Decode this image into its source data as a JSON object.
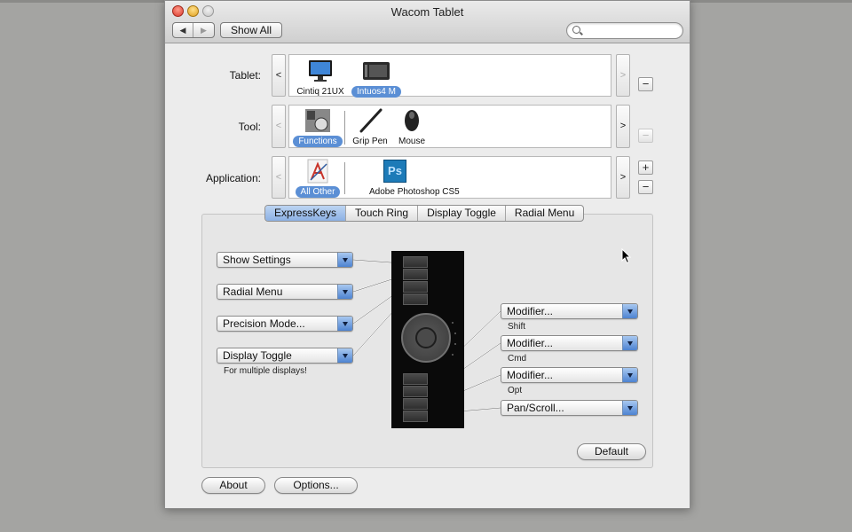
{
  "window": {
    "title": "Wacom Tablet"
  },
  "toolbar": {
    "back_glyph": "◀",
    "forward_glyph": "▶",
    "show_all": "Show All",
    "search_placeholder": ""
  },
  "rows": {
    "tablet": {
      "label": "Tablet:",
      "items": [
        {
          "name": "Cintiq 21UX",
          "icon": "monitor-icon"
        },
        {
          "name": "Intuos4 M",
          "icon": "tablet-icon",
          "selected": true
        }
      ],
      "side_buttons": [
        "−"
      ]
    },
    "tool": {
      "label": "Tool:",
      "items": [
        {
          "name": "Functions",
          "icon": "functions-icon",
          "selected": true
        },
        {
          "name": "Grip Pen",
          "icon": "pen-icon"
        },
        {
          "name": "Mouse",
          "icon": "mouse-icon"
        }
      ],
      "side_buttons": [
        "−"
      ]
    },
    "application": {
      "label": "Application:",
      "items": [
        {
          "name": "All Other",
          "icon": "all-other-apps-icon",
          "selected": true
        },
        {
          "name": "Adobe Photoshop CS5",
          "icon": "photoshop-icon",
          "badge": "Ps"
        }
      ],
      "side_buttons": [
        "+",
        "−"
      ]
    }
  },
  "arrows": {
    "left": "<",
    "right": ">"
  },
  "tabs": [
    {
      "label": "ExpressKeys",
      "active": true
    },
    {
      "label": "Touch Ring"
    },
    {
      "label": "Display Toggle"
    },
    {
      "label": "Radial Menu"
    }
  ],
  "left_keys": [
    {
      "value": "Show Settings"
    },
    {
      "value": "Radial Menu"
    },
    {
      "value": "Precision Mode..."
    },
    {
      "value": "Display Toggle",
      "note": "For multiple displays!"
    }
  ],
  "right_keys": [
    {
      "value": "Modifier...",
      "note": "Shift"
    },
    {
      "value": "Modifier...",
      "note": "Cmd"
    },
    {
      "value": "Modifier...",
      "note": "Opt"
    },
    {
      "value": "Pan/Scroll..."
    }
  ],
  "buttons": {
    "default": "Default",
    "about": "About",
    "options": "Options..."
  },
  "colors": {
    "selection": "#5b8fd5",
    "active_tab": "#8cb1e4",
    "dropdown_arrow": "#4d83d1"
  }
}
